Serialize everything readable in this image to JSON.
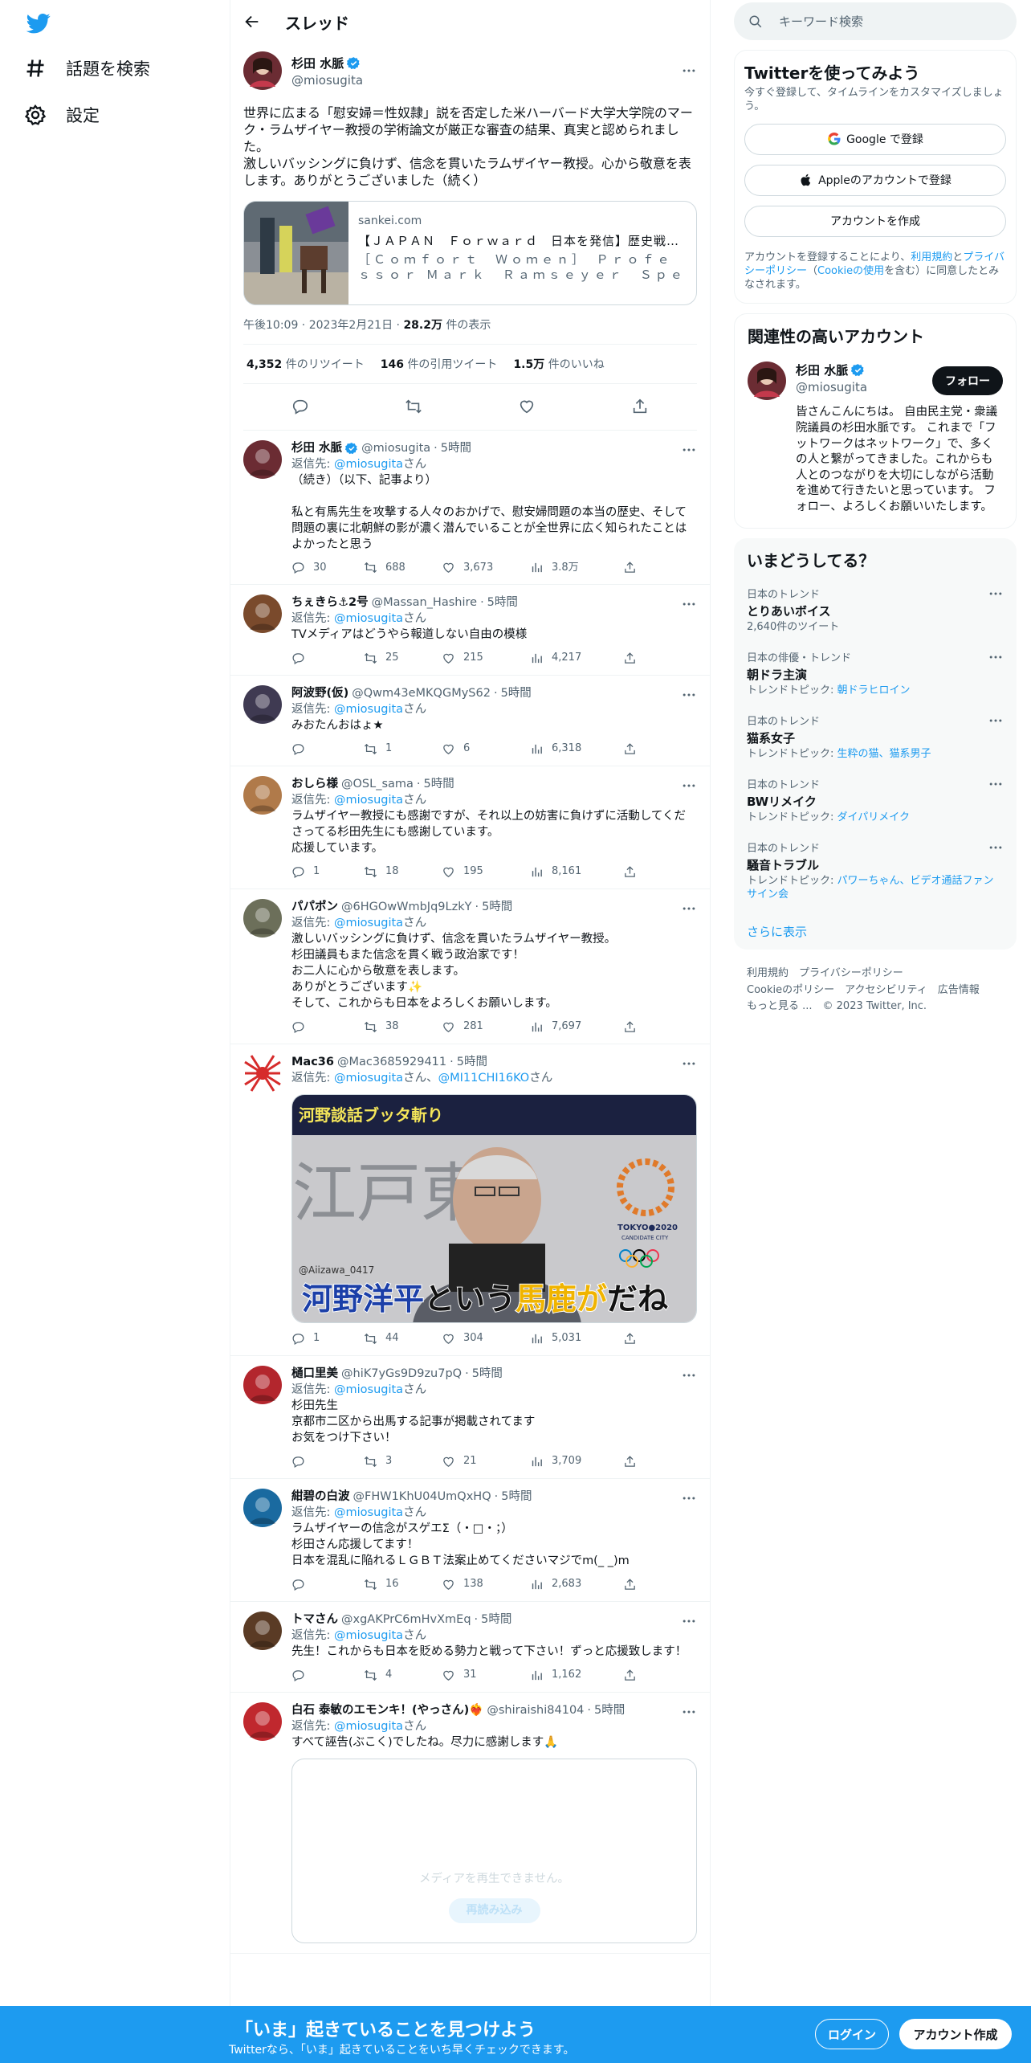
{
  "nav": {
    "explore_label": "話題を検索",
    "settings_label": "設定"
  },
  "header": {
    "title": "スレッド"
  },
  "main_tweet": {
    "name": "杉田 水脈",
    "handle": "@miosugita",
    "text": "世界に広まる「慰安婦＝性奴隷」説を否定した米ハーバード大学大学院のマーク・ラムザイヤー教授の学術論文が厳正な審査の結果、真実と認められました。\n激しいバッシングに負けず、信念を貫いたラムザイヤー教授。心から敬意を表します。ありがとうございました（続く）",
    "card": {
      "domain": "sankei.com",
      "title": "【ＪＡＰＡＮ　Ｆｏｒｗａｒｄ　日本を発信】歴史戦の大...",
      "description": "［Ｃｏｍｆｏｒｔ　Ｗｏｍｅｎ］　Ｐｒｏｆｅｓｓｏｒ Ｍａｒｋ　Ｒａｍｓｅｙｅｒ　Ｓｐｅａｋｓ　Ｏｕｔ　ａ..."
    },
    "time": "午後10:09",
    "date": "2023年2月21日",
    "views_count": "28.2万",
    "views_label": "件の表示",
    "retweets": "4,352",
    "retweets_label": "件のリツイート",
    "quotes": "146",
    "quotes_label": "件の引用ツイート",
    "likes": "1.5万",
    "likes_label": "件のいいね"
  },
  "replies": [
    {
      "name": "杉田 水脈",
      "handle": "@miosugita",
      "time": "5時間",
      "reply_to": "@miosugita",
      "reply_suffix": "さん",
      "text": "（続き）（以下、記事より）\n\n私と有馬先生を攻撃する人々のおかげで、慰安婦問題の本当の歴史、そして問題の裏に北朝鮮の影が濃く潜んでいることが全世界に広く知られたことはよかったと思う",
      "replies": "30",
      "retweets": "688",
      "likes": "3,673",
      "views": "3.8万"
    },
    {
      "name": "ちぇきら⚓2号",
      "handle": "@Massan_Hashire",
      "time": "5時間",
      "reply_to": "@miosugita",
      "reply_suffix": "さん",
      "text": "TVメディアはどうやら報道しない自由の模様",
      "replies": "",
      "retweets": "25",
      "likes": "215",
      "views": "4,217"
    },
    {
      "name": "阿波野(仮)",
      "handle": "@Qwm43eMKQGMyS62",
      "time": "5時間",
      "reply_to": "@miosugita",
      "reply_suffix": "さん",
      "text": "みおたんおはょ★",
      "replies": "",
      "retweets": "1",
      "likes": "6",
      "views": "6,318"
    },
    {
      "name": "おしら様",
      "handle": "@OSL_sama",
      "time": "5時間",
      "reply_to": "@miosugita",
      "reply_suffix": "さん",
      "text": "ラムザイヤー教授にも感謝ですが、それ以上の妨害に負けずに活動してくださってる杉田先生にも感謝しています。\n応援しています。",
      "replies": "1",
      "retweets": "18",
      "likes": "195",
      "views": "8,161"
    },
    {
      "name": "パパポン",
      "handle": "@6HGOwWmbJq9LzkY",
      "time": "5時間",
      "reply_to": "@miosugita",
      "reply_suffix": "さん",
      "text": "激しいバッシングに負けず、信念を貫いたラムザイヤー教授。\n杉田議員もまた信念を貫く戦う政治家です！\nお二人に心から敬意を表します。\nありがとうございます✨\nそして、これからも日本をよろしくお願いします。",
      "replies": "",
      "retweets": "38",
      "likes": "281",
      "views": "7,697"
    },
    {
      "name": "Mac36",
      "handle": "@Mac3685929411",
      "time": "5時間",
      "reply_to": "@miosugita",
      "reply_to_2": "@MI11CHI16KO",
      "reply_mid": "さん、",
      "reply_suffix": "さん",
      "text": "",
      "media": {
        "caption_top": "河野談話ブッタ斬り",
        "caption_bottom_a": "河野洋平",
        "caption_bottom_b": "という",
        "caption_bottom_c": "馬鹿が",
        "caption_bottom_d": "だね",
        "bg_text": "江戸東",
        "watermark": "@Aiizawa_0417",
        "logo_text": "TOKYO●2020",
        "logo_sub": "CANDIDATE CITY"
      },
      "replies": "1",
      "retweets": "44",
      "likes": "304",
      "views": "5,031"
    },
    {
      "name": "樋口里美",
      "handle": "@hiK7yGs9D9zu7pQ",
      "time": "5時間",
      "reply_to": "@miosugita",
      "reply_suffix": "さん",
      "text": "杉田先生\n京都市二区から出馬する記事が掲載されてます\nお気をつけ下さい！",
      "replies": "",
      "retweets": "3",
      "likes": "21",
      "views": "3,709"
    },
    {
      "name": "紺碧の白波",
      "handle": "@FHW1KhU04UmQxHQ",
      "time": "5時間",
      "reply_to": "@miosugita",
      "reply_suffix": "さん",
      "text": "ラムザイヤーの信念がスゲエΣ（・□・；）\n杉田さん応援してます！\n日本を混乱に陥れるＬＧＢＴ法案止めてくださいマジでm(_ _)m",
      "replies": "",
      "retweets": "16",
      "likes": "138",
      "views": "2,683"
    },
    {
      "name": "トマさん",
      "handle": "@xgAKPrC6mHvXmEq",
      "time": "5時間",
      "reply_to": "@miosugita",
      "reply_suffix": "さん",
      "text": "先生！これからも日本を貶める勢力と戦って下さい！ずっと応援致します！",
      "replies": "",
      "retweets": "4",
      "likes": "31",
      "views": "1,162"
    },
    {
      "name": "白石 泰敏のエモンキ！(やっさん)❤️‍🔥",
      "handle": "@shiraishi84104",
      "time": "5時間",
      "reply_to": "@miosugita",
      "reply_suffix": "さん",
      "text": "すべて誣告(ぶこく)でしたね。尽力に感謝します🙏",
      "media_error": "メディアを再生できません。",
      "reload_label": "再読み込み"
    }
  ],
  "search": {
    "placeholder": "キーワード検索"
  },
  "signup": {
    "title": "Twitterを使ってみよう",
    "subtitle": "今すぐ登録して、タイムラインをカスタマイズしましょう。",
    "google_label": "Google で登録",
    "apple_label": "Appleのアカウントで登録",
    "create_label": "アカウントを作成",
    "terms_a": "アカウントを登録することにより、",
    "terms_link1": "利用規約",
    "terms_b": "と",
    "terms_link2": "プライバシーポリシー",
    "terms_c": "（",
    "terms_link3": "Cookieの使用",
    "terms_d": "を含む）に同意したとみなされます。"
  },
  "related": {
    "title": "関連性の高いアカウント",
    "name": "杉田 水脈",
    "handle": "@miosugita",
    "follow_label": "フォロー",
    "bio": "皆さんこんにちは。 自由民主党・衆議院議員の杉田水脈です。 これまで「フットワークはネットワーク」で、多くの人と繋がってきました。これからも人とのつながりを大切にしながら活動を進めて行きたいと思っています。 フォロー、よろしくお願いいたします。"
  },
  "trends": {
    "title": "いまどうしてる？",
    "items": [
      {
        "category": "日本のトレンド",
        "name": "とりあいボイス",
        "sub": "2,640件のツイート",
        "sub_prefix": "",
        "links": ""
      },
      {
        "category": "日本の俳優・トレンド",
        "name": "朝ドラ主演",
        "sub": "",
        "sub_prefix": "トレンドトピック: ",
        "links": "朝ドラヒロイン"
      },
      {
        "category": "日本のトレンド",
        "name": "猫系女子",
        "sub": "",
        "sub_prefix": "トレンドトピック: ",
        "links": "生粋の猫、猫系男子"
      },
      {
        "category": "日本のトレンド",
        "name": "BWリメイク",
        "sub": "",
        "sub_prefix": "トレンドトピック: ",
        "links": "ダイパリメイク"
      },
      {
        "category": "日本のトレンド",
        "name": "騒音トラブル",
        "sub": "",
        "sub_prefix": "トレンドトピック: ",
        "links": "パワーちゃん、ビデオ通話ファンサイン会"
      }
    ],
    "show_more": "さらに表示"
  },
  "footer": {
    "line1": "利用規約　プライバシーポリシー",
    "line2": "Cookieのポリシー　アクセシビリティ　広告情報",
    "line3": "もっと見る ...　© 2023 Twitter, Inc."
  },
  "bottom_bar": {
    "title": "「いま」起きていることを見つけよう",
    "subtitle": "Twitterなら、「いま」起きていることをいち早くチェックできます。",
    "login_label": "ログイン",
    "signup_label": "アカウント作成"
  },
  "colors": {
    "accent": "#1d9bf0",
    "text": "#0f1419",
    "muted": "#536471"
  }
}
